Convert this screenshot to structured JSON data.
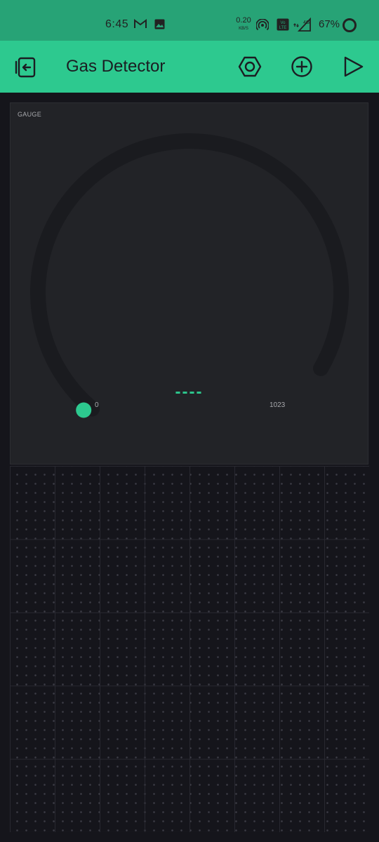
{
  "status_bar": {
    "time": "6:45",
    "net_speed_value": "0.20",
    "net_speed_unit": "KB/S",
    "battery_percent": "67%",
    "network_label": "4G"
  },
  "app_bar": {
    "title": "Gas Detector",
    "back_icon": "exit-project-icon",
    "settings_icon": "hexagon-nut-icon",
    "add_icon": "plus-circle-icon",
    "run_icon": "play-icon"
  },
  "gauge_widget": {
    "label": "GAUGE",
    "value": "----",
    "min": "0",
    "max": "1023",
    "fill_fraction": 0.0
  },
  "colors": {
    "accent": "#2dc98f",
    "status_bar": "#27a376",
    "widget_bg": "#222327",
    "canvas_bg": "#15151b"
  }
}
